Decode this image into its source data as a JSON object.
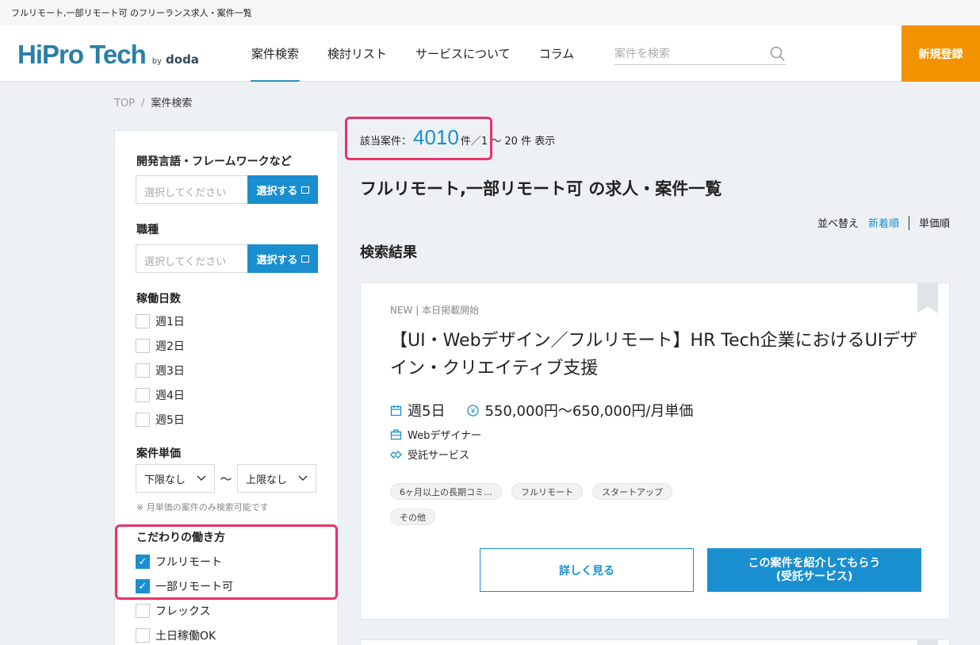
{
  "page_heading": "フルリモート,一部リモート可 のフリーランス求人・案件一覧",
  "logo": {
    "main": "HiPro Tech",
    "by": "by",
    "brand": "doda"
  },
  "nav": {
    "items": [
      "案件検索",
      "検討リスト",
      "サービスについて",
      "コラム"
    ],
    "active": "案件検索"
  },
  "search": {
    "placeholder": "案件を検索",
    "icon": "search-icon"
  },
  "register_label": "新規登録",
  "breadcrumb": {
    "home": "TOP",
    "sep": "/",
    "current": "案件検索"
  },
  "sidebar": {
    "lang": {
      "title": "開発言語・フレームワークなど",
      "placeholder": "選択してください",
      "button": "選択する"
    },
    "job": {
      "title": "職種",
      "placeholder": "選択してください",
      "button": "選択する"
    },
    "days": {
      "title": "稼働日数",
      "options": [
        "週1日",
        "週2日",
        "週3日",
        "週4日",
        "週5日"
      ]
    },
    "price": {
      "title": "案件単価",
      "min": "下限なし",
      "tilde": "〜",
      "max": "上限なし",
      "note": "※ 月単価の案件のみ検索可能です"
    },
    "work_style": {
      "title": "こだわりの働き方",
      "options": [
        {
          "label": "フルリモート",
          "checked": true
        },
        {
          "label": "一部リモート可",
          "checked": true
        },
        {
          "label": "フレックス",
          "checked": false
        },
        {
          "label": "土日稼働OK",
          "checked": false
        }
      ]
    }
  },
  "results": {
    "count_label": "該当案件：",
    "count": "4010",
    "count_suffix": "件",
    "range": "／1 〜 20 件 表示",
    "title": "フルリモート,一部リモート可 の求人・案件一覧",
    "sort_label": "並べ替え",
    "sort_new": "新着順",
    "sort_price": "単価順",
    "heading": "検索結果"
  },
  "card": {
    "meta": "NEW | 本日掲載開始",
    "title": "【UI・Webデザイン／フルリモート】HR Tech企業におけるUIデザイン・クリエイティブ支援",
    "days": "週5日",
    "price": "550,000円〜650,000円/月単価",
    "role": "Webデザイナー",
    "service": "受託サービス",
    "tags": [
      "6ヶ月以上の長期コミ…",
      "フルリモート",
      "スタートアップ",
      "その他"
    ],
    "detail_button": "詳しく見る",
    "intro_button_line1": "この案件を紹介してもらう",
    "intro_button_line2": "(受託サービス)"
  },
  "colors": {
    "accent": "#1a8fd0",
    "register": "#f39200",
    "annotation": "#e8336b"
  }
}
